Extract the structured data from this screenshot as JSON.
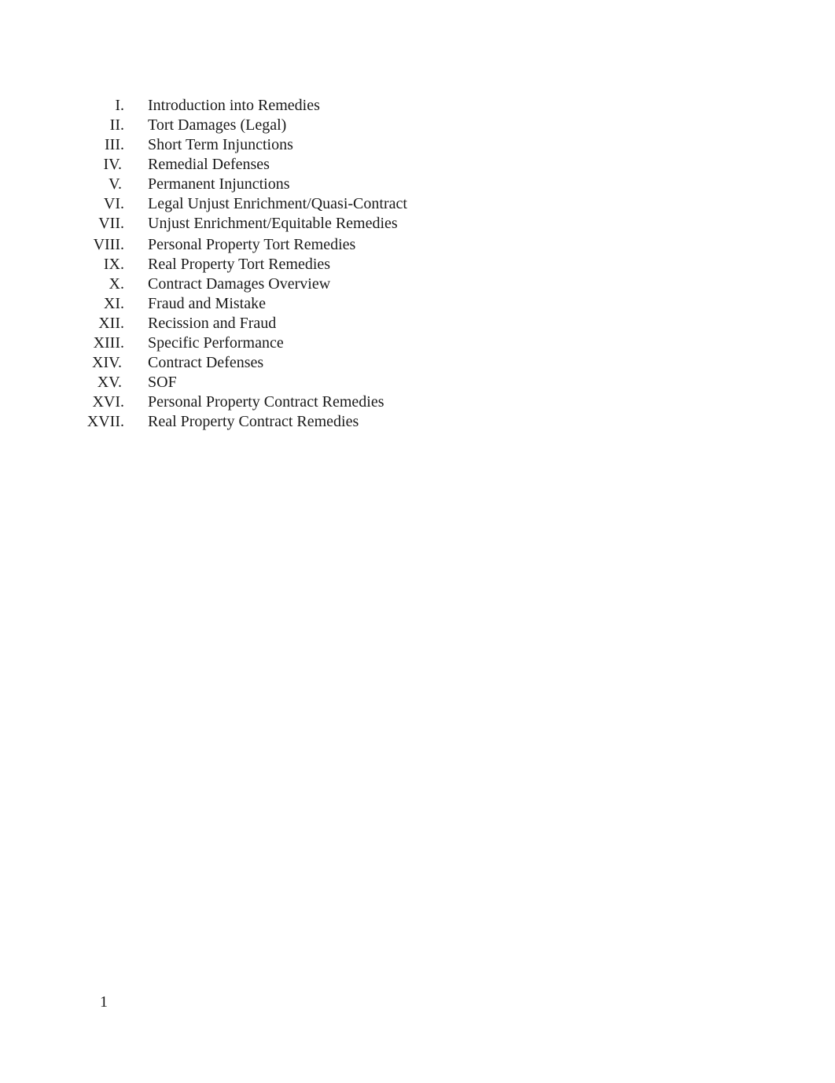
{
  "document": {
    "outline": [
      {
        "numeral": "I.",
        "text": "Introduction into Remedies"
      },
      {
        "numeral": "II.",
        "text": "Tort Damages (Legal)"
      },
      {
        "numeral": "III.",
        "text": "Short Term Injunctions"
      },
      {
        "numeral": "IV.",
        "text": "Remedial Defenses"
      },
      {
        "numeral": "V.",
        "text": "Permanent Injunctions"
      },
      {
        "numeral": "VI.",
        "text": "Legal Unjust Enrichment/Quasi-Contract"
      },
      {
        "numeral": "VII.",
        "text": "Unjust Enrichment/Equitable Remedies"
      },
      {
        "numeral": "VIII.",
        "text": "Personal Property Tort Remedies"
      },
      {
        "numeral": "IX.",
        "text": "Real Property Tort Remedies"
      },
      {
        "numeral": "X.",
        "text": "Contract Damages Overview"
      },
      {
        "numeral": "XI.",
        "text": "Fraud and Mistake"
      },
      {
        "numeral": "XII.",
        "text": "Recission and Fraud"
      },
      {
        "numeral": "XIII.",
        "text": "Specific Performance"
      },
      {
        "numeral": "XIV.",
        "text": "Contract Defenses"
      },
      {
        "numeral": "XV.",
        "text": "SOF"
      },
      {
        "numeral": "XVI.",
        "text": "Personal Property Contract Remedies"
      },
      {
        "numeral": "XVII.",
        "text": "Real Property Contract Remedies"
      }
    ],
    "page_number": "1"
  }
}
